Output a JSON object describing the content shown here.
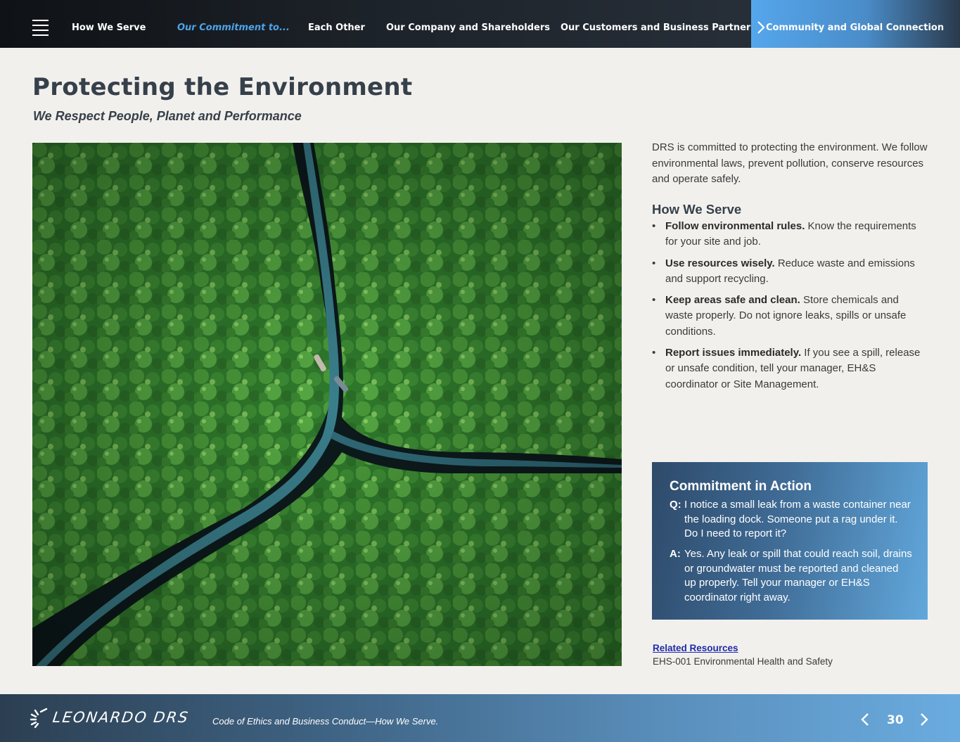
{
  "nav": {
    "items": [
      {
        "label": "How We Serve"
      },
      {
        "label": "Our Commitment to..."
      },
      {
        "label": "Each Other"
      },
      {
        "label": "Our Company and Shareholders"
      },
      {
        "label": "Our Customers and Business Partners"
      }
    ],
    "active_label": "Community and Global Connection",
    "menu_icon": "hamburger-icon"
  },
  "header": {
    "title": "Protecting the Environment",
    "subtitle": "We Respect People, Planet and Performance"
  },
  "body": {
    "intro": "DRS is committed to protecting the environment. We follow environmental laws, prevent pollution, conserve resources and operate safely.",
    "section_heading": "How We Serve",
    "bullets": [
      {
        "bold": "Follow environmental rules.",
        "text": " Know the requirements for your site and job."
      },
      {
        "bold": "Use resources wisely.",
        "text": " Reduce waste and emissions and support recycling."
      },
      {
        "bold": "Keep areas safe and clean.",
        "text": " Store chemicals and waste properly. Do not ignore leaks, spills or unsafe conditions."
      },
      {
        "bold": "Report issues immediately.",
        "text": " If you see a spill, release or unsafe condition, tell your manager, EH&S coordinator or Site Management."
      }
    ]
  },
  "callout": {
    "title": "Commitment in Action",
    "q_label": "Q:",
    "q_text": "I notice a small leak from a waste container near the loading dock. Someone put a rag under it. Do I need to report it?",
    "a_label": "A:",
    "a_text": "Yes. Any leak or spill that could reach soil, drains or groundwater must be reported and cleaned up properly. Tell your manager or EH&S coordinator right away."
  },
  "resources": {
    "link_label": "Related Resources",
    "items": [
      "EHS-001 Environmental Health and Safety"
    ]
  },
  "footer": {
    "logo_text": "LEONARDO DRS",
    "tagline": "Code of Ethics and Business Conduct—How We Serve.",
    "page_number": "30"
  },
  "colors": {
    "nav_bg": "#14181d",
    "nav_accent": "#4da3e8",
    "title_color": "#36404a",
    "callout_start": "#2e4a6a",
    "callout_end": "#62a8dc",
    "link_color": "#1f2aa8",
    "page_bg": "#f2f0ed"
  }
}
